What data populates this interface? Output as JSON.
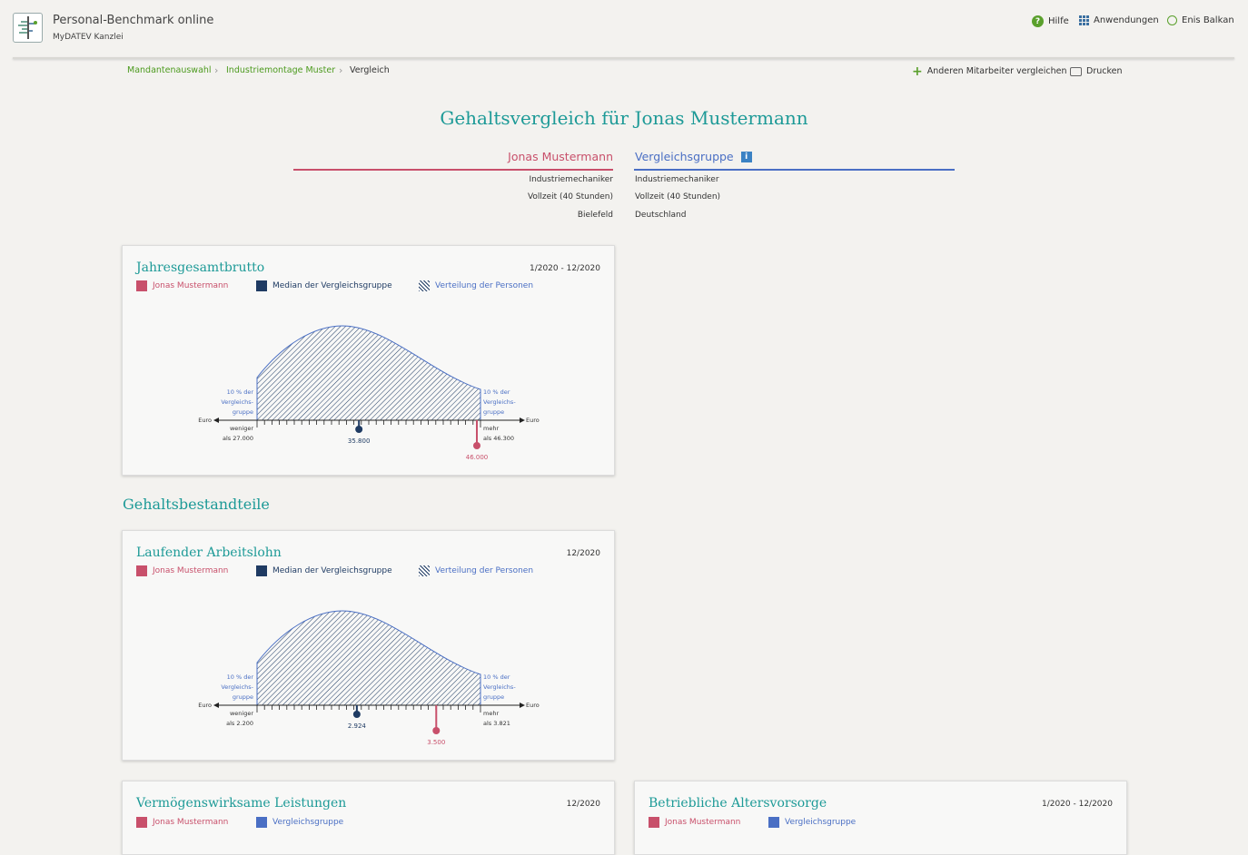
{
  "app": {
    "title": "Personal-Benchmark online",
    "subtitle": "MyDATEV Kanzlei",
    "help": "Hilfe",
    "apps": "Anwendungen",
    "user": "Enis Balkan"
  },
  "breadcrumb": {
    "items": [
      "Mandantenauswahl",
      "Industriemontage Muster",
      "Vergleich"
    ]
  },
  "actions": {
    "compare": "Anderen Mitarbeiter vergleichen",
    "print": "Drucken"
  },
  "page_title": "Gehaltsvergleich für Jonas Mustermann",
  "comparison": {
    "left_name": "Jonas Mustermann",
    "right_name": "Vergleichsgruppe",
    "left_attrs": [
      "Industriemechaniker",
      "Vollzeit (40 Stunden)",
      "Bielefeld"
    ],
    "right_attrs": [
      "Industriemechaniker",
      "Vollzeit (40 Stunden)",
      "Deutschland"
    ]
  },
  "colors": {
    "teal": "#1d9a97",
    "person": "#c8506b",
    "median": "#1f3b63",
    "group": "#4a6fc4"
  },
  "legend": {
    "person": "Jonas Mustermann",
    "median": "Median der Vergleichsgruppe",
    "distribution": "Verteilung der Personen",
    "group": "Vergleichsgruppe"
  },
  "chart_labels": {
    "tail_line1": "10 % der",
    "tail_line2": "Vergleichs-",
    "tail_line3": "gruppe",
    "axis_unit": "Euro",
    "less": "weniger",
    "more": "mehr"
  },
  "cards": {
    "jahr": {
      "title": "Jahresgesamtbrutto",
      "date": "1/2020 - 12/2020",
      "low": "als 27.000",
      "high": "als 46.300",
      "median_label": "35.800",
      "person_label": "46.000"
    },
    "lfd": {
      "title": "Laufender Arbeitslohn",
      "date": "12/2020",
      "low": "als 2.200",
      "high": "als 3.821",
      "median_label": "2.924",
      "person_label": "3.500"
    },
    "vwl": {
      "title": "Vermögenswirksame Leistungen",
      "date": "12/2020"
    },
    "bav": {
      "title": "Betriebliche Altersvorsorge",
      "date": "1/2020 - 12/2020"
    }
  },
  "section_title": "Gehaltsbestandteile",
  "chart_data": [
    {
      "type": "area",
      "title": "Jahresgesamtbrutto",
      "xlabel": "Euro",
      "x_range": [
        27000,
        46300
      ],
      "series": [
        {
          "name": "Median der Vergleichsgruppe",
          "values": [
            35800
          ]
        },
        {
          "name": "Jonas Mustermann",
          "values": [
            46000
          ]
        }
      ]
    },
    {
      "type": "area",
      "title": "Laufender Arbeitslohn",
      "xlabel": "Euro",
      "x_range": [
        2200,
        3821
      ],
      "series": [
        {
          "name": "Median der Vergleichsgruppe",
          "values": [
            2924
          ]
        },
        {
          "name": "Jonas Mustermann",
          "values": [
            3500
          ]
        }
      ]
    }
  ]
}
